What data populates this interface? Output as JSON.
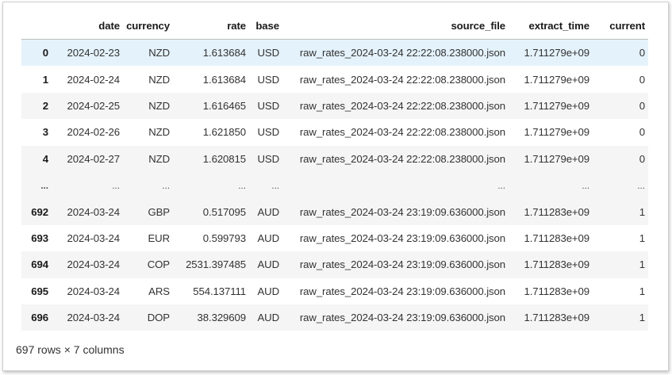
{
  "table": {
    "columns": [
      "",
      "date",
      "currency",
      "rate",
      "base",
      "source_file",
      "extract_time",
      "current"
    ],
    "rows": [
      {
        "index": "0",
        "date": "2024-02-23",
        "currency": "NZD",
        "rate": "1.613684",
        "base": "USD",
        "source_file": "raw_rates_2024-03-24 22:22:08.238000.json",
        "extract_time": "1.711279e+09",
        "current": "0"
      },
      {
        "index": "1",
        "date": "2024-02-24",
        "currency": "NZD",
        "rate": "1.613684",
        "base": "USD",
        "source_file": "raw_rates_2024-03-24 22:22:08.238000.json",
        "extract_time": "1.711279e+09",
        "current": "0"
      },
      {
        "index": "2",
        "date": "2024-02-25",
        "currency": "NZD",
        "rate": "1.616465",
        "base": "USD",
        "source_file": "raw_rates_2024-03-24 22:22:08.238000.json",
        "extract_time": "1.711279e+09",
        "current": "0"
      },
      {
        "index": "3",
        "date": "2024-02-26",
        "currency": "NZD",
        "rate": "1.621850",
        "base": "USD",
        "source_file": "raw_rates_2024-03-24 22:22:08.238000.json",
        "extract_time": "1.711279e+09",
        "current": "0"
      },
      {
        "index": "4",
        "date": "2024-02-27",
        "currency": "NZD",
        "rate": "1.620815",
        "base": "USD",
        "source_file": "raw_rates_2024-03-24 22:22:08.238000.json",
        "extract_time": "1.711279e+09",
        "current": "0"
      },
      {
        "index": "...",
        "date": "...",
        "currency": "...",
        "rate": "...",
        "base": "...",
        "source_file": "...",
        "extract_time": "...",
        "current": "..."
      },
      {
        "index": "692",
        "date": "2024-03-24",
        "currency": "GBP",
        "rate": "0.517095",
        "base": "AUD",
        "source_file": "raw_rates_2024-03-24 23:19:09.636000.json",
        "extract_time": "1.711283e+09",
        "current": "1"
      },
      {
        "index": "693",
        "date": "2024-03-24",
        "currency": "EUR",
        "rate": "0.599793",
        "base": "AUD",
        "source_file": "raw_rates_2024-03-24 23:19:09.636000.json",
        "extract_time": "1.711283e+09",
        "current": "1"
      },
      {
        "index": "694",
        "date": "2024-03-24",
        "currency": "COP",
        "rate": "2531.397485",
        "base": "AUD",
        "source_file": "raw_rates_2024-03-24 23:19:09.636000.json",
        "extract_time": "1.711283e+09",
        "current": "1"
      },
      {
        "index": "695",
        "date": "2024-03-24",
        "currency": "ARS",
        "rate": "554.137111",
        "base": "AUD",
        "source_file": "raw_rates_2024-03-24 23:19:09.636000.json",
        "extract_time": "1.711283e+09",
        "current": "1"
      },
      {
        "index": "696",
        "date": "2024-03-24",
        "currency": "DOP",
        "rate": "38.329609",
        "base": "AUD",
        "source_file": "raw_rates_2024-03-24 23:19:09.636000.json",
        "extract_time": "1.711283e+09",
        "current": "1"
      }
    ]
  },
  "footer": {
    "shape_text": "697 rows × 7 columns"
  },
  "colors": {
    "hover_row": "#e4f2fb",
    "striped_row": "#f5f5f5"
  }
}
